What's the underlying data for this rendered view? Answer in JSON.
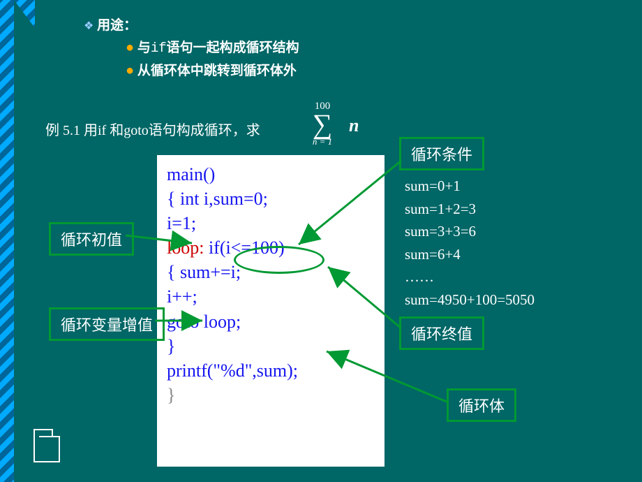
{
  "header": {
    "usage_label": "用途：",
    "point1_prefix": "与",
    "point1_mono": "if",
    "point1_suffix": "语句一起构成循环结构",
    "point2": "从循环体中跳转到循环体外"
  },
  "example": {
    "prefix": "例 5.1 用if 和goto语句构成循环，求",
    "sigma_top": "100",
    "sigma_sym": "∑",
    "sigma_bottom": "n = 1",
    "sigma_var": "n"
  },
  "code": {
    "l1": "main()",
    "l2": "{     int i,sum=0;",
    "l3": "      i=1;",
    "l4a": "loop:",
    "l4b": " if(i<=100)",
    "l5": "       {  sum+=i;",
    "l6": "           i++;",
    "l7": "           goto loop;",
    "l8": "       }",
    "l9": "       printf(\"%d\",sum);",
    "l10": "}"
  },
  "labels": {
    "init": "循环初值",
    "incr": "循环变量增值",
    "cond": "循环条件",
    "end": "循环终值",
    "body": "循环体"
  },
  "trace": {
    "t1": "sum=0+1",
    "t2": "sum=1+2=3",
    "t3": "sum=3+3=6",
    "t4": "sum=6+4",
    "t5": "……",
    "t6": "sum=4950+100=5050"
  }
}
